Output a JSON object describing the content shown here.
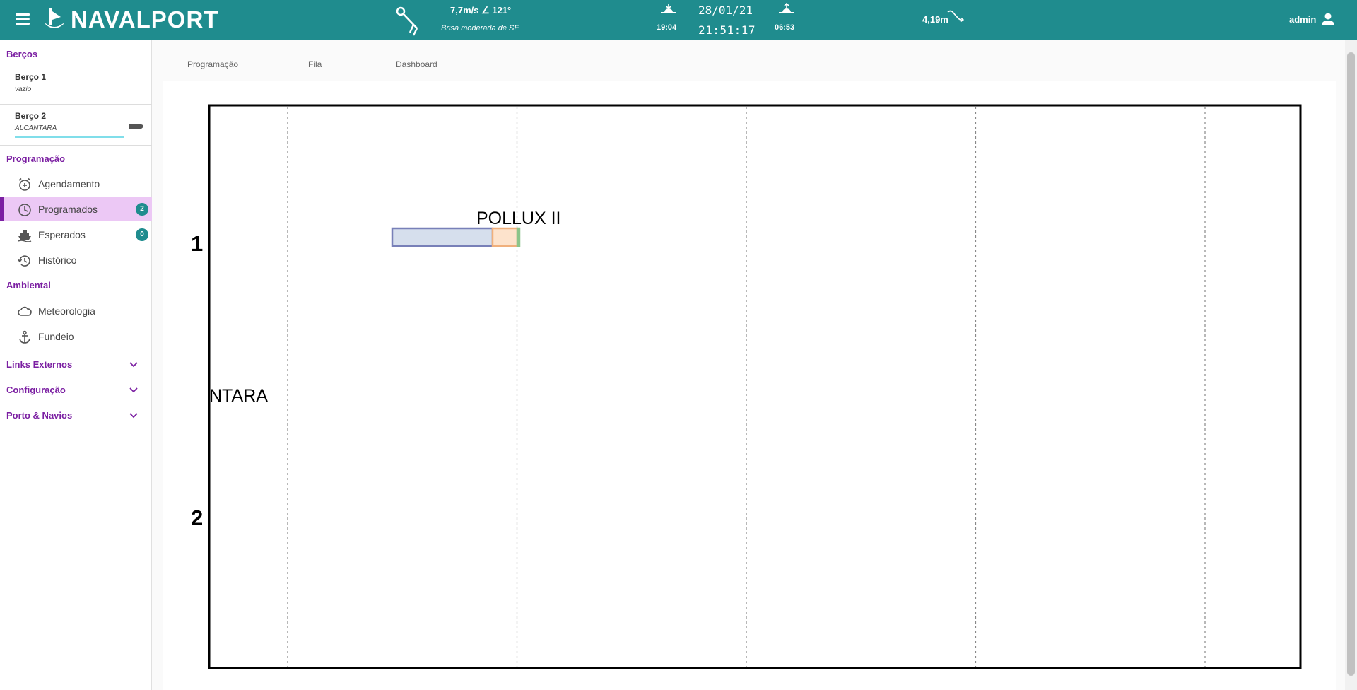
{
  "header": {
    "app_name": "NAVALPORT",
    "wind_speed": "7,7m/s ∠ 121°",
    "wind_description": "Brisa moderada de SE",
    "sunset_time": "19:04",
    "date": "28/01/21",
    "time": "21:51:17",
    "sunrise_time": "06:53",
    "tide": "4,19m",
    "user": "admin",
    "color": "#1f8c8e"
  },
  "sidebar": {
    "berths_title": "Berços",
    "berths": [
      {
        "name": "Berço 1",
        "status": "vazio"
      },
      {
        "name": "Berço 2",
        "status": "ALCANTARA"
      }
    ],
    "programacao_title": "Programação",
    "programacao_items": [
      {
        "label": "Agendamento",
        "icon": "alarm-add-icon"
      },
      {
        "label": "Programados",
        "icon": "clock-icon",
        "badge": "2",
        "active": true
      },
      {
        "label": "Esperados",
        "icon": "ship-icon",
        "badge": "0"
      },
      {
        "label": "Histórico",
        "icon": "history-icon"
      }
    ],
    "ambiental_title": "Ambiental",
    "ambiental_items": [
      {
        "label": "Meteorologia",
        "icon": "cloud-icon"
      },
      {
        "label": "Fundeio",
        "icon": "anchor-icon"
      }
    ],
    "groups": [
      {
        "label": "Links Externos"
      },
      {
        "label": "Configuração"
      },
      {
        "label": "Porto & Navios"
      }
    ],
    "accent_color": "#7b1fa2"
  },
  "tabs": [
    "Programação",
    "Fila",
    "Dashboard"
  ],
  "chart_data": {
    "type": "gantt",
    "rows": [
      "1",
      "2"
    ],
    "bars": [
      {
        "row": "1",
        "label": "POLLUX II",
        "segments": [
          "planned",
          "maneuver",
          "departure"
        ]
      },
      {
        "row": "2",
        "label": "NTARA",
        "segments": []
      }
    ],
    "vertical_gridlines": 5,
    "colors": {
      "planned": "#d6dfed",
      "planned_border": "#7880b8",
      "maneuver": "#fde3cc",
      "maneuver_border": "#f0b07c",
      "departure": "#8bc48a"
    }
  }
}
